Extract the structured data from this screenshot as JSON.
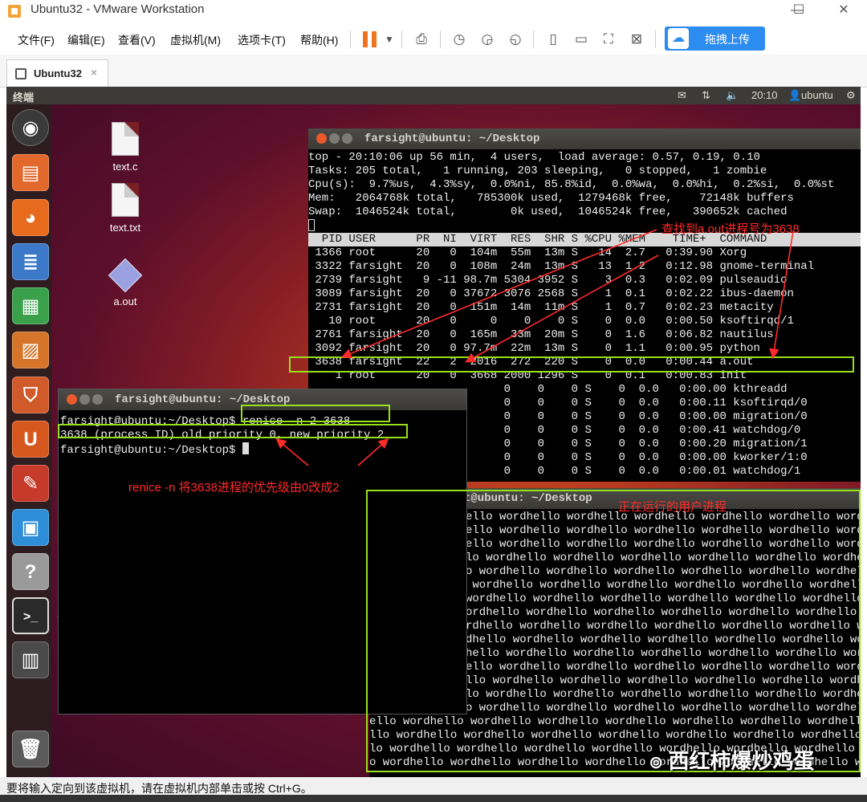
{
  "window": {
    "title": "Ubuntu32 - VMware Workstation",
    "controls": [
      "—",
      "☐",
      "✕"
    ]
  },
  "menubar": {
    "items": [
      "文件(F)",
      "编辑(E)",
      "查看(V)",
      "虚拟机(M)",
      "选项卡(T)",
      "帮助(H)"
    ],
    "upload_label": "拖拽上传"
  },
  "tabs": [
    {
      "label": "Ubuntu32",
      "close": "×"
    }
  ],
  "ubuntu_panel": {
    "title": "终端",
    "time": "20:10",
    "user": "ubuntu",
    "icons": [
      "mail-icon",
      "network-icon",
      "volume-icon",
      "gear-icon"
    ]
  },
  "launcher": {
    "items": [
      "dash-icon",
      "files-icon",
      "firefox-icon",
      "writer-icon",
      "calc-icon",
      "impress-icon",
      "software-center-icon",
      "ubuntu-one-icon",
      "settings-icon",
      "workspaces-icon",
      "help-icon",
      "terminal-icon",
      "workspace-switcher-icon",
      "trash-icon"
    ],
    "tooltip": "终端"
  },
  "desktop_icons": [
    {
      "label": "text.c"
    },
    {
      "label": "text.txt"
    },
    {
      "label": "a.out"
    }
  ],
  "top_terminal": {
    "title": "farsight@ubuntu: ~/Desktop",
    "summary": [
      "top - 20:10:06 up 56 min,  4 users,  load average: 0.57, 0.19, 0.10",
      "Tasks: 205 total,   1 running, 203 sleeping,   0 stopped,   1 zombie",
      "Cpu(s):  9.7%us,  4.3%sy,  0.0%ni, 85.8%id,  0.0%wa,  0.0%hi,  0.2%si,  0.0%st",
      "Mem:   2064768k total,   785300k used,  1279468k free,    72148k buffers",
      "Swap:  1046524k total,        0k used,  1046524k free,   390652k cached"
    ],
    "header": "  PID USER      PR  NI  VIRT  RES  SHR S %CPU %MEM    TIME+  COMMAND",
    "rows": [
      " 1366 root      20   0  104m  55m  13m S   14  2.7   0:39.90 Xorg",
      " 3322 farsight  20   0  108m  24m  13m S   13  1.2   0:12.98 gnome-terminal",
      " 2739 farsight   9 -11 98.7m 5304 3952 S    3  0.3   0:02.09 pulseaudio",
      " 3089 farsight  20   0 37672 3076 2568 S    1  0.1   0:02.22 ibus-daemon",
      " 2731 farsight  20   0  151m  14m  11m S    1  0.7   0:02.23 metacity",
      "   10 root      20   0     0    0    0 S    0  0.0   0:00.50 ksoftirqd/1",
      " 2761 farsight  20   0  165m  33m  20m S    0  1.6   0:06.82 nautilus",
      " 3092 farsight  20   0 97.7m  22m  13m S    0  1.1   0:00.95 python",
      " 3638 farsight  22   2  2016  272  220 S    0  0.0   0:00.44 a.out",
      "    1 root      20   0  3668 2000 1296 S    0  0.1   0:00.83 init",
      "                             0    0    0 S    0  0.0   0:00.00 kthreadd",
      "                             0    0    0 S    0  0.0   0:00.11 ksoftirqd/0",
      "                             0    0    0 S    0  0.0   0:00.00 migration/0",
      "                             0    0    0 S    0  0.0   0:00.41 watchdog/0",
      "                             0    0    0 S    0  0.0   0:00.20 migration/1",
      "                             0    0    0 S    0  0.0   0:00.00 kworker/1:0",
      "                             0    0    0 S    0  0.0   0:00.01 watchdog/1"
    ]
  },
  "renice_terminal": {
    "title": "farsight@ubuntu: ~/Desktop",
    "lines": [
      "farsight@ubuntu:~/Desktop$ renice -n 2 3638",
      "3638 (process ID) old priority 0, new priority 2",
      "farsight@ubuntu:~/Desktop$ "
    ]
  },
  "hello_terminal": {
    "title": "t@ubuntu: ~/Desktop",
    "lines": [
      "ello wordhello wordhello wordhello wordhello wordhello wordhello w",
      "ello wordhello wordhello wordhello wordhello wordhello wordhello w",
      "ello wordhello wordhello wordhello wordhello wordhello wordhello w",
      "lo wordhello wordhello wordhello wordhello wordhello wordhello word",
      "o wordhello wordhello wordhello wordhello wordhello wordhello wordh",
      " wordhello wordhello wordhello wordhello wordhello wordhello wordhe",
      "wordhello wordhello wordhello wordhello wordhello wordhello wordhel",
      "ordhello wordhello wordhello wordhello wordhello wordhello wordhell",
      "rdhello wordhello wordhello wordhello wordhello wordhello wordhello",
      "dhello wordhello wordhello wordhello wordhello wordhello wordhello",
      "hello wordhello wordhello wordhello wordhello wordhello wordhello w",
      "ello wordhello wordhello wordhello wordhello wordhello wordhello w",
      "llo wordhello wordhello wordhello wordhello wordhello wordhello wo",
      "lo wordhello wordhello wordhello wordhello wordhello wordhello word",
      "o wordhello wordhello wordhello wordhello wordhello wordhello wordh"
    ],
    "wide_lines": [
      "ello wordhello wordhello wordhello wordhello wordhello wordhello wordhello wordhello wordhe",
      "llo wordhello wordhello wordhello wordhello wordhello wordhello wordhello wordhello wordhel",
      "lo wordhello wordhello wordhello wordhello wordhello wordhello wordhello wordhello wordhell",
      "o wordhello wordhello wordhello wordhello wordhello wordhello wordhello wordhello wordhello"
    ]
  },
  "annotations": {
    "find_pid": "查找到a.out进程号为3638",
    "renice_note": "renice -n 将3638进程的优先级由0改成2",
    "running_note": "正在运行的用户进程",
    "accent": "#98e01a",
    "note_color": "#ff2b2b"
  },
  "watermark": "西红柿爆炒鸡蛋",
  "statusbar": {
    "text": "要将输入定向到该虚拟机，请在虚拟机内部单击或按 Ctrl+G。"
  }
}
